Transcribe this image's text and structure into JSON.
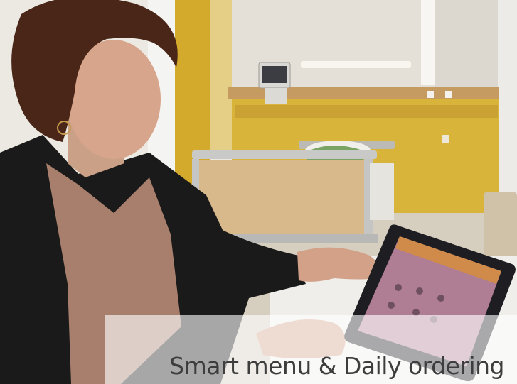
{
  "caption": {
    "text": "Smart menu & Daily ordering"
  },
  "colors": {
    "wall_yellow": "#d9b43a",
    "wall_upper": "#ece9e2",
    "wood_panel": "#c9a77a",
    "jacket": "#1b1a1a",
    "shirt": "#a77f6c",
    "hair": "#4a2618",
    "skin": "#d7a58b",
    "tablet_frame": "#1e1e22",
    "tablet_screen": "#b07e94"
  },
  "icons": [
    "bed-illustration",
    "monitor-illustration",
    "tablet-illustration"
  ]
}
